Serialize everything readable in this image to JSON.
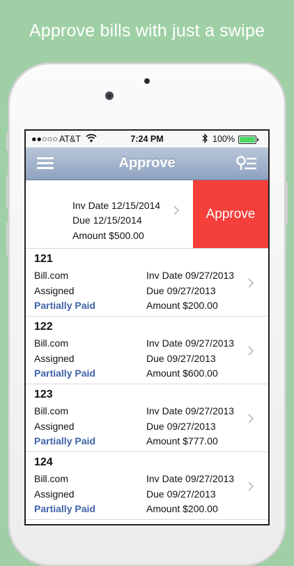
{
  "headline": "Approve bills with just a swipe",
  "status_bar": {
    "signal": "●●○○○",
    "carrier": "AT&T",
    "time": "7:24 PM",
    "battery": "100%"
  },
  "nav": {
    "title": "Approve",
    "left_icon": "menu-icon",
    "right_icon": "filter-icon"
  },
  "swiped_row": {
    "inv_date": "Inv Date 12/15/2014",
    "due_date": "Due 12/15/2014",
    "amount": "Amount $500.00",
    "action_label": "Approve",
    "action_color": "#f43f3a"
  },
  "bills": [
    {
      "number": "121",
      "vendor": "Bill.com",
      "assignment": "Assigned",
      "status": "Partially Paid",
      "inv_date": "Inv Date 09/27/2013",
      "due_date": "Due 09/27/2013",
      "amount": "Amount $200.00"
    },
    {
      "number": "122",
      "vendor": "Bill.com",
      "assignment": "Assigned",
      "status": "Partially Paid",
      "inv_date": "Inv Date 09/27/2013",
      "due_date": "Due 09/27/2013",
      "amount": "Amount $600.00"
    },
    {
      "number": "123",
      "vendor": "Bill.com",
      "assignment": "Assigned",
      "status": "Partially Paid",
      "inv_date": "Inv Date 09/27/2013",
      "due_date": "Due 09/27/2013",
      "amount": "Amount $777.00"
    },
    {
      "number": "124",
      "vendor": "Bill.com",
      "assignment": "Assigned",
      "status": "Partially Paid",
      "inv_date": "Inv Date 09/27/2013",
      "due_date": "Due 09/27/2013",
      "amount": "Amount $200.00"
    }
  ],
  "colors": {
    "background": "#9fd0a5",
    "status_link": "#3f62a8",
    "nav_gradient_top": "#b9c6d8",
    "nav_gradient_bottom": "#8ea2bf"
  }
}
